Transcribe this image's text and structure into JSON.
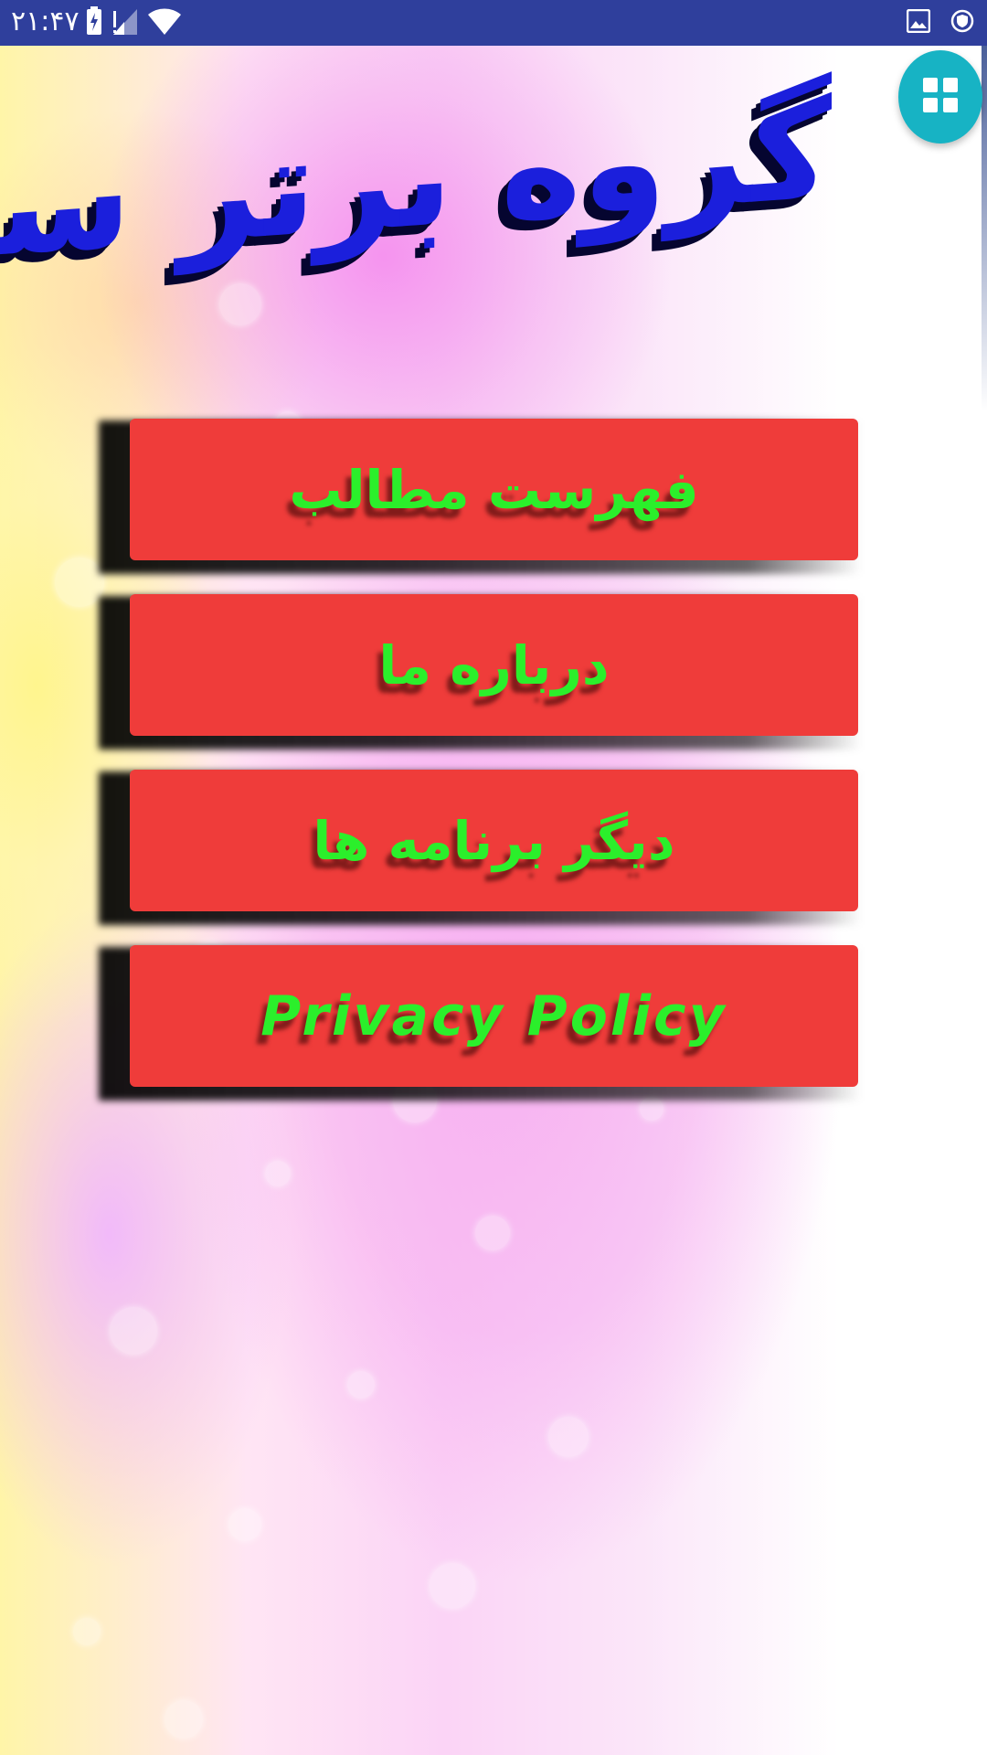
{
  "status_bar": {
    "time": "۲۱:۴۷",
    "icons": [
      "battery-charging-icon",
      "cellular-signal-icon",
      "wifi-icon",
      "image-notification-icon",
      "vpn-shield-icon"
    ],
    "background_color": "#2f3f9c"
  },
  "header": {
    "title": "گروه برتر سافت",
    "title_color": "#1b1fdc"
  },
  "fab": {
    "icon": "grid-apps-icon",
    "color": "#17b3c4"
  },
  "menu": {
    "button_color": "#ef3c3a",
    "label_color": "#2bef2b",
    "items": [
      {
        "label": "فهرست مطالب"
      },
      {
        "label": "درباره ما"
      },
      {
        "label": "دیگر برنامه ها"
      },
      {
        "label": "Privacy Policy"
      }
    ]
  }
}
